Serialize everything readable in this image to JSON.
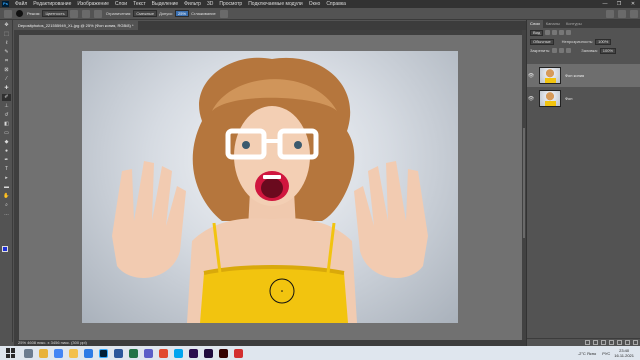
{
  "app": {
    "logo": "Ps",
    "menus": [
      "Файл",
      "Редактирование",
      "Изображение",
      "Слои",
      "Текст",
      "Выделение",
      "Фильтр",
      "3D",
      "Просмотр",
      "Подключаемые модули",
      "Окно",
      "Справка"
    ],
    "window_controls": [
      "—",
      "❐",
      "✕"
    ]
  },
  "options": {
    "mode_label": "Режим:",
    "mode_value": "Цветность",
    "opacity_label": "Непрозр.:",
    "opacity_value": "100%",
    "sample_label": "Ограничения:",
    "sample_value": "Смежные",
    "tolerance_label": "Допуск:",
    "tolerance_value": "25%",
    "antialias_label": "Сглаживание"
  },
  "document": {
    "tab_title": "Depositphotos_221555949_XL.jpg @ 25% (Фон копия, RGB/8) *",
    "status_text": "25%      4608 пикс. x 3456 пикс. (300 ppi)"
  },
  "layers_panel": {
    "tabs": [
      "Слои",
      "Каналы",
      "Контуры"
    ],
    "filter_label": "Вид",
    "blend_mode": "Обычные",
    "opacity_label": "Непрозрачность:",
    "opacity_value": "100%",
    "lock_label": "Закрепить:",
    "fill_label": "Заливка:",
    "fill_value": "100%",
    "layers": [
      {
        "name": "Фон копия",
        "visible": "👁",
        "selected": true
      },
      {
        "name": "Фон",
        "visible": "👁",
        "selected": false
      }
    ]
  },
  "taskbar": {
    "weather": "-2°C  Ясно",
    "lang": "РУС",
    "time": "23:40",
    "date": "16.11.2021",
    "apps": [
      "explorer",
      "chrome",
      "folder",
      "mail",
      "photoshop",
      "word",
      "excel",
      "store",
      "media",
      "browser",
      "premiere",
      "aftereffects",
      "illustrator",
      "acrobat"
    ]
  },
  "colors": {
    "foreground": "#1e2fd6",
    "background": "#ffffff",
    "top_yellow": "#f2c40f"
  }
}
